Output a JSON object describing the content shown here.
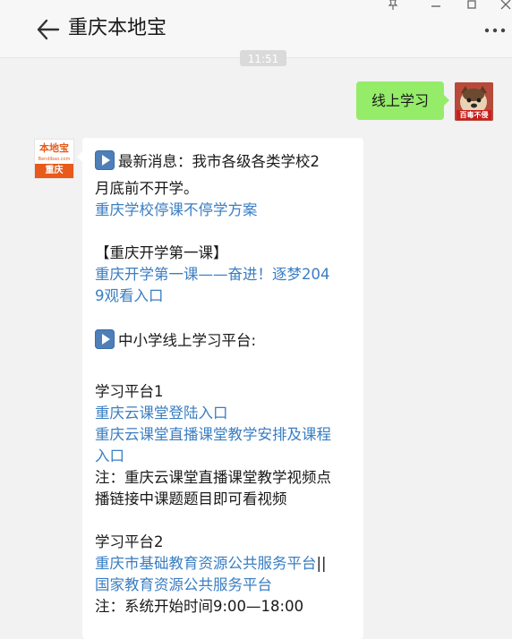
{
  "header": {
    "title": "重庆本地宝"
  },
  "chat": {
    "timestamp": "11:51",
    "user_message": "线上学习",
    "user_avatar_badge": "百毒不侵",
    "bot_avatar": {
      "logo_text": "本地宝",
      "logo_sub": "Bendibao.com",
      "city": "重庆"
    },
    "reply": {
      "line1": "最新消息：我市各级各类学校2",
      "line2": "月底前不开学。",
      "link1": "重庆学校停课不停学方案",
      "section1": "【重庆开学第一课】",
      "link2a": "重庆开学第一课——奋进！逐梦204",
      "link2b": "9观看入口",
      "section2": "中小学线上学习平台:",
      "platform1": "学习平台1",
      "link3": "重庆云课堂登陆入口",
      "link4a": "重庆云课堂直播课堂教学安排及课程",
      "link4b": "入口",
      "note1a": "注：重庆云课堂直播课堂教学视频点",
      "note1b": "播链接中课题题目即可看视频",
      "platform2": "学习平台2",
      "link5": "重庆市基础教育资源公共服务平台",
      "separator": "||",
      "link6": "国家教育资源公共服务平台",
      "note2": "注：系统开始时间9:00—18:00"
    }
  },
  "icons": {
    "back": "arrow-left-icon",
    "more": "more-dots-icon",
    "play": "play-button-emoji-icon",
    "pin": "pin-icon",
    "minimize": "minimize-icon",
    "maximize": "maximize-icon",
    "close": "close-icon"
  }
}
